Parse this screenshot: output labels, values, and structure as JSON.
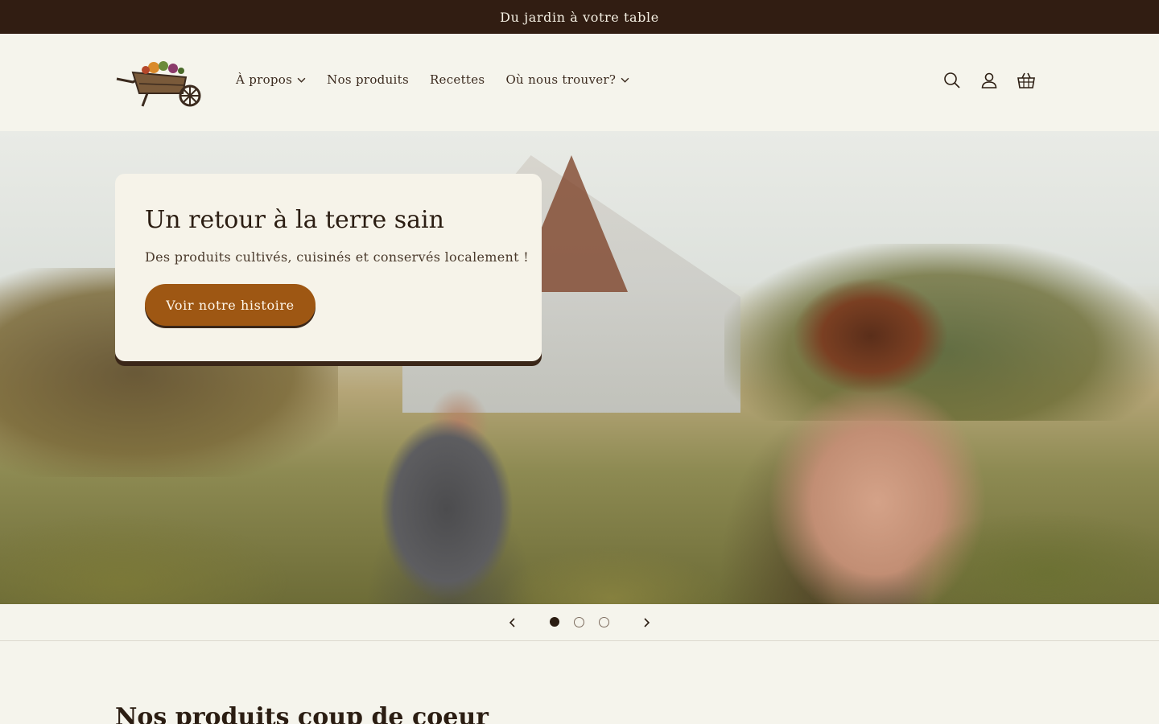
{
  "announcement": {
    "text": "Du jardin à votre table"
  },
  "header": {
    "nav": [
      {
        "label": "À propos",
        "has_dropdown": true
      },
      {
        "label": "Nos produits",
        "has_dropdown": false
      },
      {
        "label": "Recettes",
        "has_dropdown": false
      },
      {
        "label": "Où nous trouver?",
        "has_dropdown": true
      }
    ],
    "icons": [
      "search-icon",
      "account-icon",
      "cart-icon"
    ]
  },
  "hero": {
    "title": "Un retour à la terre sain",
    "subtitle": "Des produits cultivés, cuisinés et conservés localement !",
    "button_label": "Voir notre histoire"
  },
  "slider": {
    "slide_count": 3,
    "active_slide": 1
  },
  "section": {
    "title": "Nos produits coup de coeur"
  },
  "colors": {
    "announcement_bg": "#311d12",
    "accent": "#9e5713",
    "page_bg": "#f5f4ec"
  }
}
